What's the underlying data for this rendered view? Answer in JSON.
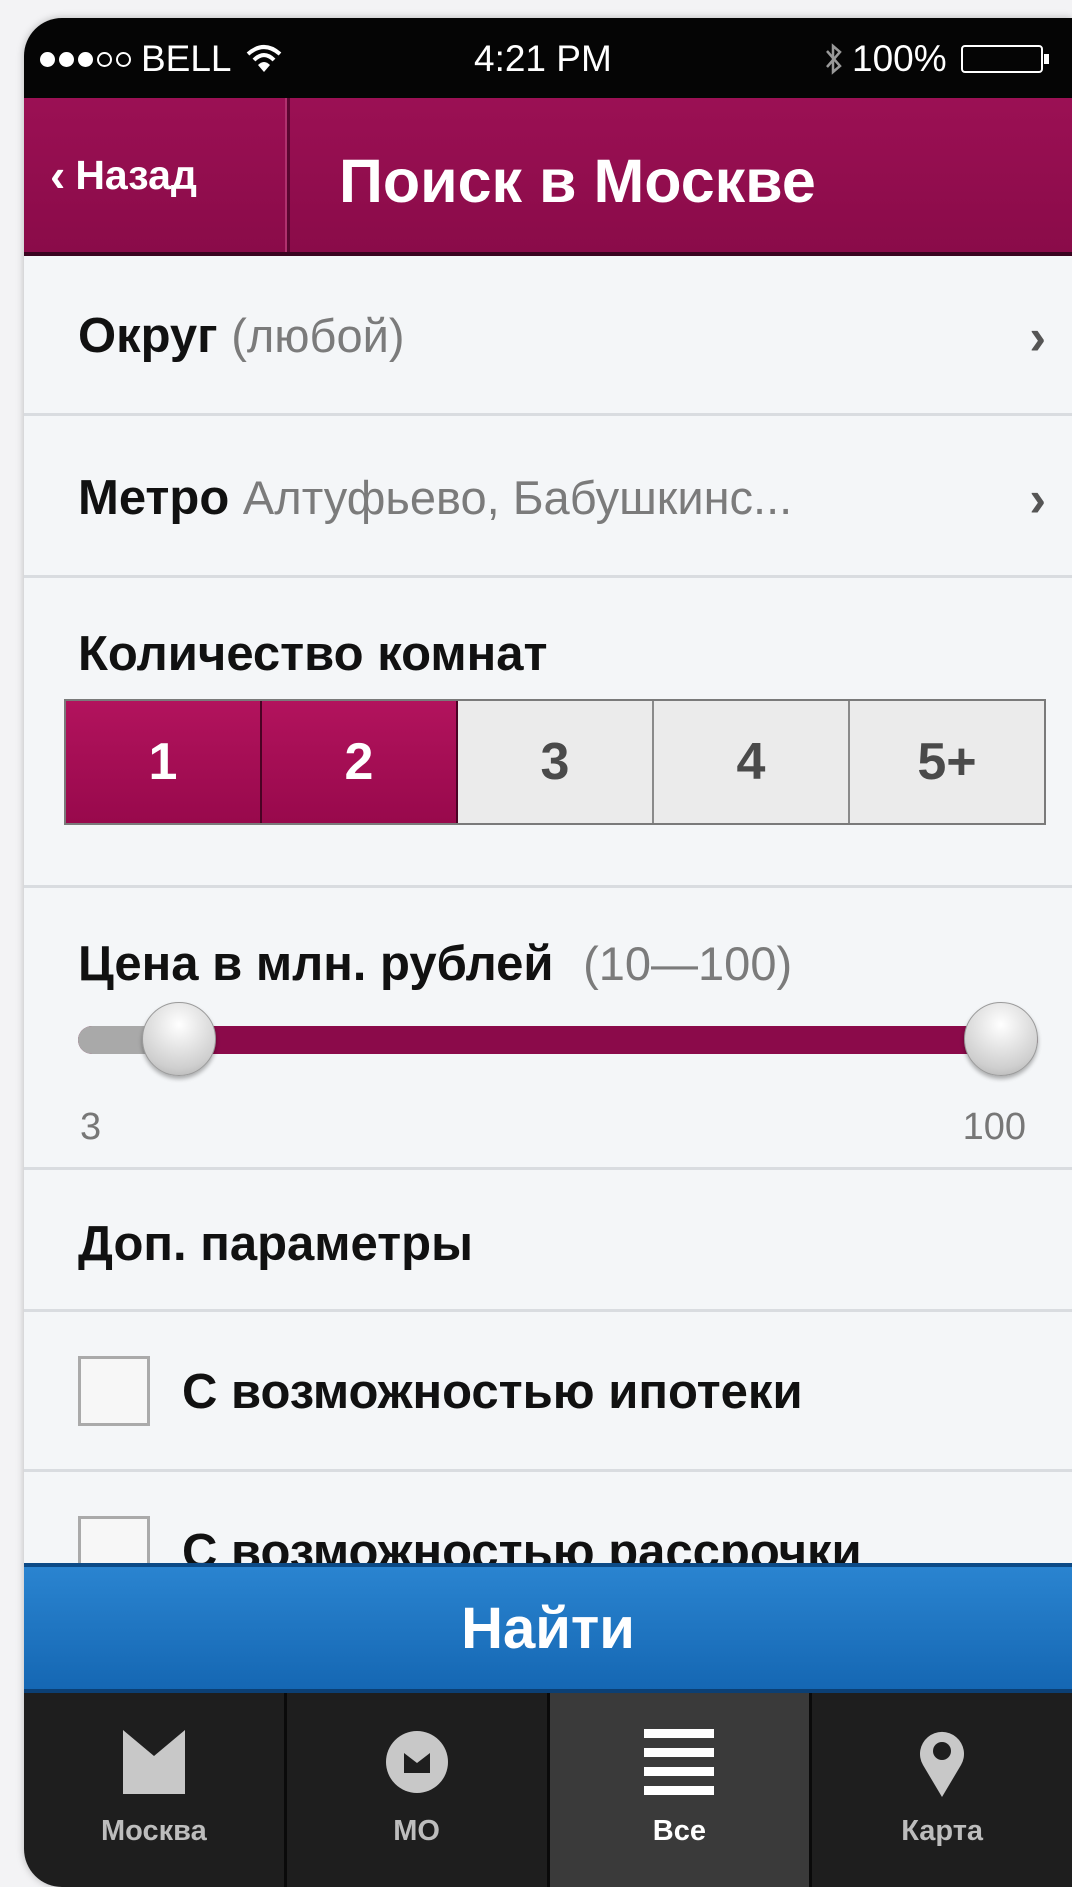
{
  "status_bar": {
    "carrier": "BELL",
    "time": "4:21 PM",
    "battery": "100%"
  },
  "nav": {
    "back_label": "Назад",
    "title": "Поиск в Москве"
  },
  "district": {
    "label": "Округ",
    "value": "(любой)"
  },
  "metro": {
    "label": "Метро",
    "value": "Алтуфьево, Бабушкинс..."
  },
  "rooms": {
    "label": "Количество комнат",
    "options": [
      "1",
      "2",
      "3",
      "4",
      "5+"
    ],
    "selected": [
      "1",
      "2"
    ]
  },
  "price": {
    "label": "Цена в млн. рублей",
    "range_text": "(10—100)",
    "min_label": "3",
    "max_label": "100",
    "low_value": 10,
    "high_value": 100,
    "scale_min": 3,
    "scale_max": 100
  },
  "extra": {
    "label": "Доп. параметры"
  },
  "checkboxes": [
    {
      "label": "С возможностью ипотеки",
      "checked": false
    },
    {
      "label": "С возможностью рассрочки",
      "checked": false
    }
  ],
  "find_button": "Найти",
  "tabs": [
    {
      "label": "Москва",
      "icon": "moscow-m-icon",
      "active": false
    },
    {
      "label": "МО",
      "icon": "region-badge-icon",
      "active": false
    },
    {
      "label": "Все",
      "icon": "list-icon",
      "active": true
    },
    {
      "label": "Карта",
      "icon": "map-pin-icon",
      "active": false
    }
  ],
  "colors": {
    "brand": "#8b0a4a",
    "find_button": "#1d72bf",
    "tabbar": "#1e1e1e"
  }
}
